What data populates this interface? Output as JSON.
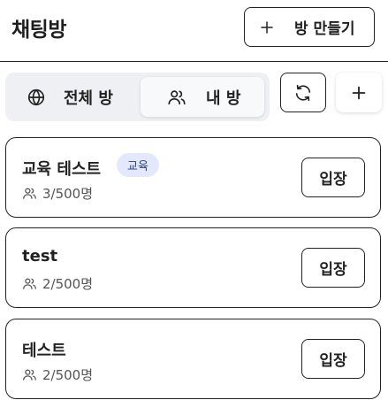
{
  "header": {
    "title": "채팅방",
    "create_button": {
      "label": "방 만들기",
      "icon": "plus-icon"
    }
  },
  "tabs": [
    {
      "label": "전체 방",
      "icon": "globe-icon",
      "active": false
    },
    {
      "label": "내 방",
      "icon": "users-icon",
      "active": true
    }
  ],
  "actions": {
    "refresh_icon": "refresh-icon",
    "add_icon": "plus-icon"
  },
  "rooms": [
    {
      "name": "교육 테스트",
      "tag": "교육",
      "members": "3/500명",
      "enter_label": "입장"
    },
    {
      "name": "test",
      "tag": "",
      "members": "2/500명",
      "enter_label": "입장"
    },
    {
      "name": "테스트",
      "tag": "",
      "members": "2/500명",
      "enter_label": "입장"
    }
  ],
  "colors": {
    "tag_bg": "#e3e9fb",
    "tag_text": "#2b3f8f",
    "tabs_bg": "#eef0f3"
  }
}
